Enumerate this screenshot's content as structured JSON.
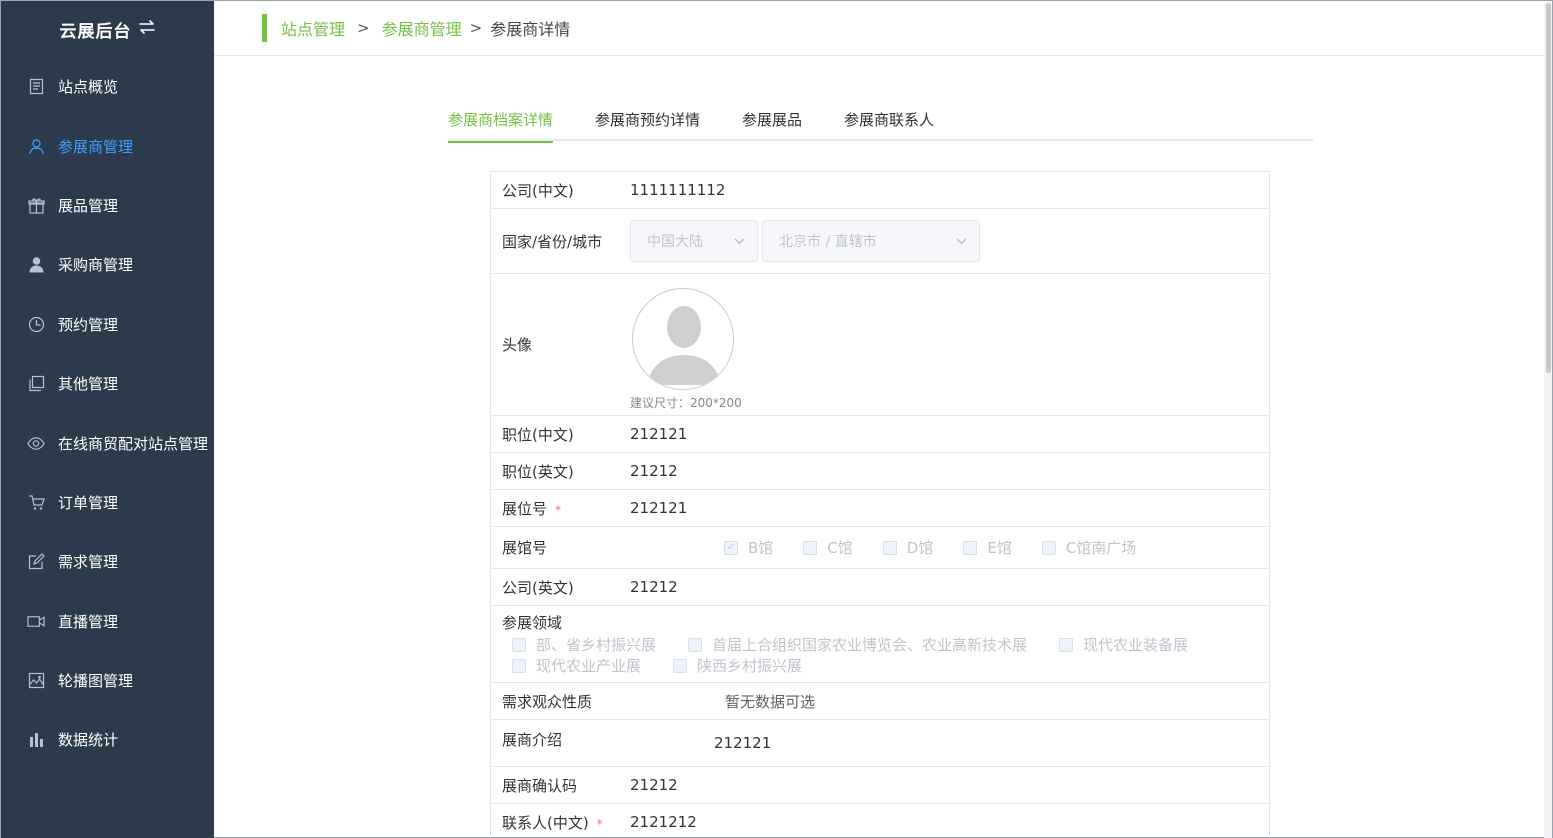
{
  "app": {
    "brand": "云展后台",
    "swap_icon": "swap-icon"
  },
  "sidebar": {
    "items": [
      {
        "label": "站点概览",
        "icon": "document-icon",
        "active": false
      },
      {
        "label": "参展商管理",
        "icon": "user-icon",
        "active": true
      },
      {
        "label": "展品管理",
        "icon": "gift-icon",
        "active": false
      },
      {
        "label": "采购商管理",
        "icon": "person-icon",
        "active": false
      },
      {
        "label": "预约管理",
        "icon": "clock-icon",
        "active": false
      },
      {
        "label": "其他管理",
        "icon": "copy-icon",
        "active": false
      },
      {
        "label": "在线商贸配对站点管理",
        "icon": "eye-icon",
        "active": false
      },
      {
        "label": "订单管理",
        "icon": "cart-icon",
        "active": false
      },
      {
        "label": "需求管理",
        "icon": "edit-icon",
        "active": false
      },
      {
        "label": "直播管理",
        "icon": "video-icon",
        "active": false
      },
      {
        "label": "轮播图管理",
        "icon": "image-icon",
        "active": false
      },
      {
        "label": "数据统计",
        "icon": "bar-chart-icon",
        "active": false
      }
    ]
  },
  "breadcrumb": {
    "site": "站点管理",
    "exhibitors": "参展商管理",
    "current": "参展商详情",
    "separator": ">"
  },
  "tabs": [
    {
      "label": "参展商档案详情",
      "active": true
    },
    {
      "label": "参展商预约详情",
      "active": false
    },
    {
      "label": "参展展品",
      "active": false
    },
    {
      "label": "参展商联系人",
      "active": false
    }
  ],
  "form": {
    "company_cn": {
      "label": "公司(中文)",
      "value": "1111111112"
    },
    "location": {
      "label": "国家/省份/城市",
      "country": "中国大陆",
      "city": "北京市 / 直辖市"
    },
    "avatar": {
      "label": "头像",
      "hint": "建议尺寸：200*200"
    },
    "position_cn": {
      "label": "职位(中文)",
      "value": "212121"
    },
    "position_en": {
      "label": "职位(英文)",
      "value": "21212"
    },
    "booth_no": {
      "label": "展位号",
      "required_mark": "*",
      "value": "212121"
    },
    "hall_no": {
      "label": "展馆号",
      "options": [
        {
          "label": "B馆",
          "checked": true
        },
        {
          "label": "C馆",
          "checked": false
        },
        {
          "label": "D馆",
          "checked": false
        },
        {
          "label": "E馆",
          "checked": false
        },
        {
          "label": "C馆南广场",
          "checked": false
        }
      ]
    },
    "company_en": {
      "label": "公司(英文)",
      "value": "21212"
    },
    "fields": {
      "label": "参展领域",
      "options": [
        {
          "label": "部、省乡村振兴展",
          "checked": false
        },
        {
          "label": "首届上合组织国家农业博览会、农业高新技术展",
          "checked": false
        },
        {
          "label": "现代农业装备展",
          "checked": false
        },
        {
          "label": "现代农业产业展",
          "checked": false
        },
        {
          "label": "陕西乡村振兴展",
          "checked": false
        }
      ]
    },
    "audience": {
      "label": "需求观众性质",
      "value": "暂无数据可选"
    },
    "intro": {
      "label": "展商介绍",
      "value": "212121"
    },
    "confirm_code": {
      "label": "展商确认码",
      "value": "21212"
    },
    "contact_cn": {
      "label": "联系人(中文)",
      "required_mark": "*",
      "value": "2121212"
    }
  },
  "colors": {
    "sidebar_bg": "#2b3b4c",
    "accent_green": "#76c043",
    "active_blue": "#409eff"
  }
}
